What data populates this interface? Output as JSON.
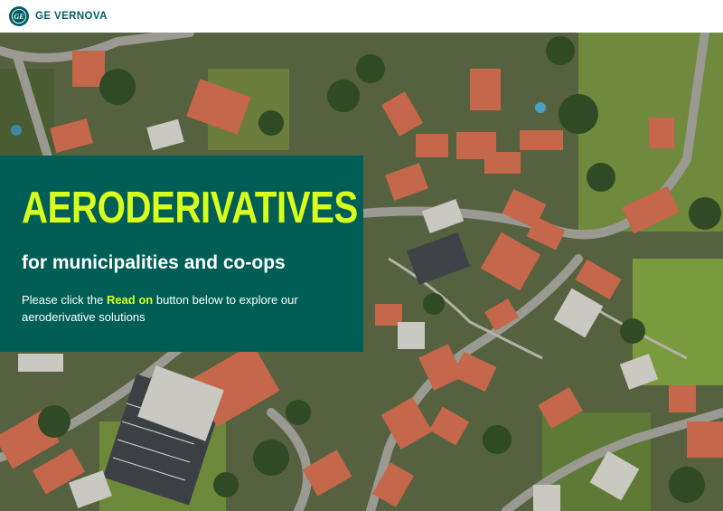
{
  "header": {
    "brand_name": "GE VERNOVA",
    "logo_icon": "ge-monogram-icon",
    "brand_color": "#005e60"
  },
  "hero": {
    "image_icon": "aerial-town-photo",
    "title": "AERODERIVATIVES",
    "subtitle": "for municipalities and co-ops",
    "body_before": "Please click the ",
    "body_link": "Read on",
    "body_after": " button below to explore our aeroderivative solutions",
    "panel_color": "#005e56",
    "accent_color": "#d9ff1f"
  }
}
